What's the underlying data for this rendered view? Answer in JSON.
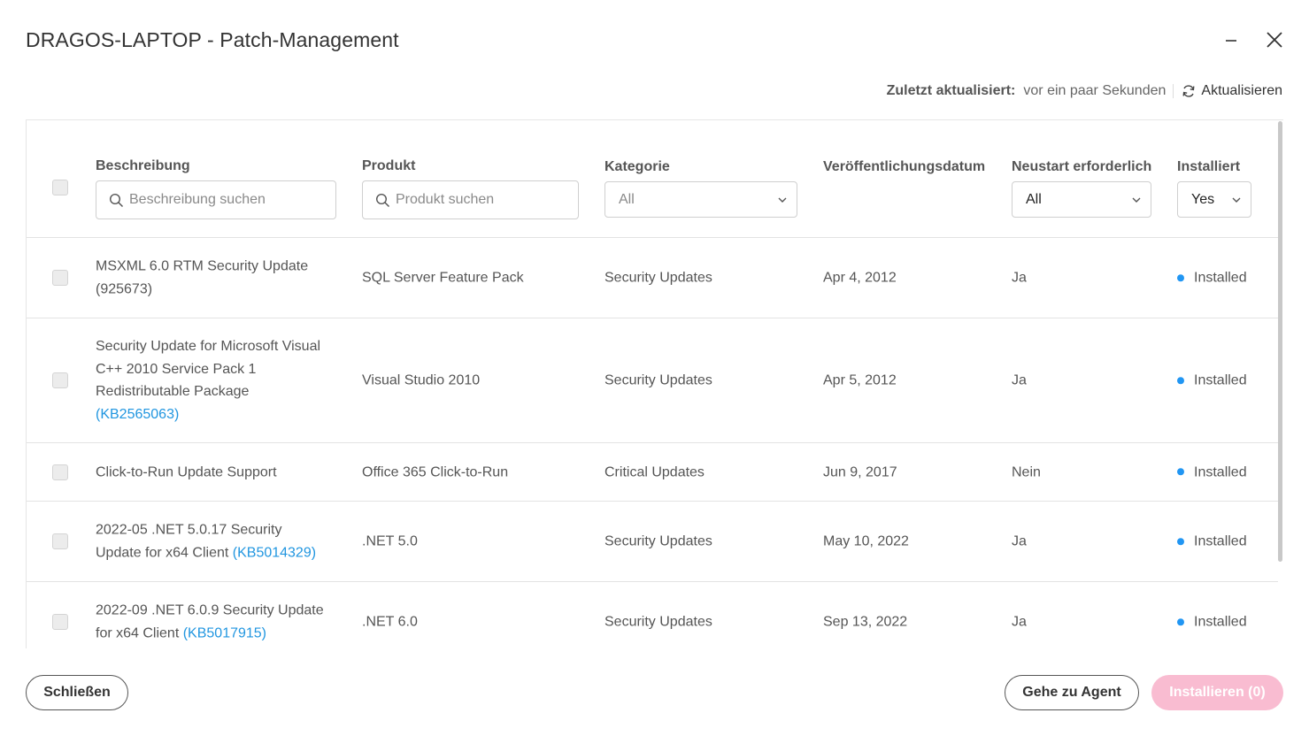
{
  "window": {
    "title": "DRAGOS-LAPTOP - Patch-Management"
  },
  "status_bar": {
    "updated_label": "Zuletzt aktualisiert:",
    "updated_value": "vor ein paar Sekunden",
    "refresh_label": "Aktualisieren"
  },
  "table": {
    "columns": {
      "description": "Beschreibung",
      "product": "Produkt",
      "category": "Kategorie",
      "release_date": "Veröffentlichungsdatum",
      "restart": "Neustart erforderlich",
      "installed": "Installiert"
    },
    "filters": {
      "description_placeholder": "Beschreibung suchen",
      "product_placeholder": "Produkt suchen",
      "category_value": "All",
      "restart_value": "All",
      "installed_value": "Yes"
    },
    "rows": [
      {
        "desc_lines": [
          "MSXML 6.0 RTM Security Update",
          "(925673)"
        ],
        "product": "SQL Server Feature Pack",
        "category": "Security Updates",
        "date": "Apr 4, 2012",
        "restart": "Ja",
        "status": "Installed"
      },
      {
        "desc_lines": [
          "Security Update for Microsoft Visual",
          "C++ 2010 Service Pack 1",
          "Redistributable Package"
        ],
        "kb": "(KB2565063)",
        "product": "Visual Studio 2010",
        "category": "Security Updates",
        "date": "Apr 5, 2012",
        "restart": "Ja",
        "status": "Installed"
      },
      {
        "desc_lines": [
          "Click-to-Run Update Support"
        ],
        "product": "Office 365 Click-to-Run",
        "category": "Critical Updates",
        "date": "Jun 9, 2017",
        "restart": "Nein",
        "status": "Installed"
      },
      {
        "desc_lines": [
          "2022-05 .NET 5.0.17 Security",
          "Update for x64 Client"
        ],
        "kb": "(KB5014329)",
        "product": ".NET 5.0",
        "category": "Security Updates",
        "date": "May 10, 2022",
        "restart": "Ja",
        "status": "Installed"
      },
      {
        "desc_lines": [
          "2022-09 .NET 6.0.9 Security Update",
          "for x64 Client"
        ],
        "kb": "(KB5017915)",
        "product": ".NET 6.0",
        "category": "Security Updates",
        "date": "Sep 13, 2022",
        "restart": "Ja",
        "status": "Installed"
      }
    ]
  },
  "footer": {
    "close_label": "Schließen",
    "agent_label": "Gehe zu Agent",
    "install_label": "Installieren (0)"
  },
  "colors": {
    "accent": "#2196e0",
    "install_disabled": "#f9bcd1",
    "status_dot": "#2196f3"
  }
}
